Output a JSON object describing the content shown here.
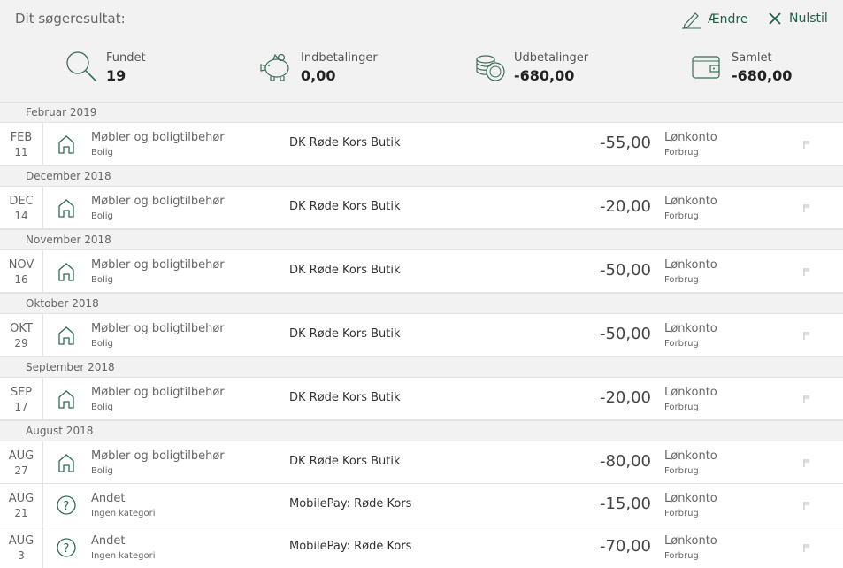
{
  "header": {
    "title": "Dit søgeresultat:",
    "edit_label": "Ændre",
    "reset_label": "Nulstil"
  },
  "summary": {
    "found_label": "Fundet",
    "found_value": "19",
    "in_label": "Indbetalinger",
    "in_value": "0,00",
    "out_label": "Udbetalinger",
    "out_value": "-680,00",
    "total_label": "Samlet",
    "total_value": "-680,00"
  },
  "sections": [
    "Februar 2019",
    "December 2018",
    "November 2018",
    "Oktober 2018",
    "September 2018",
    "August 2018"
  ],
  "transactions": [
    {
      "month": "FEB",
      "day": "11",
      "category": "Møbler og boligtilbehør",
      "subcategory": "Bolig",
      "merchant": "DK Røde Kors Butik",
      "amount": "-55,00",
      "account": "Lønkonto",
      "account_type": "Forbrug",
      "icon": "house-icon"
    },
    {
      "month": "DEC",
      "day": "14",
      "category": "Møbler og boligtilbehør",
      "subcategory": "Bolig",
      "merchant": "DK Røde Kors Butik",
      "amount": "-20,00",
      "account": "Lønkonto",
      "account_type": "Forbrug",
      "icon": "house-icon"
    },
    {
      "month": "NOV",
      "day": "16",
      "category": "Møbler og boligtilbehør",
      "subcategory": "Bolig",
      "merchant": "DK Røde Kors Butik",
      "amount": "-50,00",
      "account": "Lønkonto",
      "account_type": "Forbrug",
      "icon": "house-icon"
    },
    {
      "month": "OKT",
      "day": "29",
      "category": "Møbler og boligtilbehør",
      "subcategory": "Bolig",
      "merchant": "DK Røde Kors Butik",
      "amount": "-50,00",
      "account": "Lønkonto",
      "account_type": "Forbrug",
      "icon": "house-icon"
    },
    {
      "month": "SEP",
      "day": "17",
      "category": "Møbler og boligtilbehør",
      "subcategory": "Bolig",
      "merchant": "DK Røde Kors Butik",
      "amount": "-20,00",
      "account": "Lønkonto",
      "account_type": "Forbrug",
      "icon": "house-icon"
    },
    {
      "month": "AUG",
      "day": "27",
      "category": "Møbler og boligtilbehør",
      "subcategory": "Bolig",
      "merchant": "DK Røde Kors Butik",
      "amount": "-80,00",
      "account": "Lønkonto",
      "account_type": "Forbrug",
      "icon": "house-icon"
    },
    {
      "month": "AUG",
      "day": "21",
      "category": "Andet",
      "subcategory": "Ingen kategori",
      "merchant": "MobilePay: Røde Kors",
      "amount": "-15,00",
      "account": "Lønkonto",
      "account_type": "Forbrug",
      "icon": "question-icon"
    },
    {
      "month": "AUG",
      "day": "3",
      "category": "Andet",
      "subcategory": "Ingen kategori",
      "merchant": "MobilePay: Røde Kors",
      "amount": "-70,00",
      "account": "Lønkonto",
      "account_type": "Forbrug",
      "icon": "question-icon"
    }
  ],
  "colors": {
    "accent": "#1f5f46",
    "header_bg": "#f2f2f2",
    "border": "#e3e3e3"
  }
}
